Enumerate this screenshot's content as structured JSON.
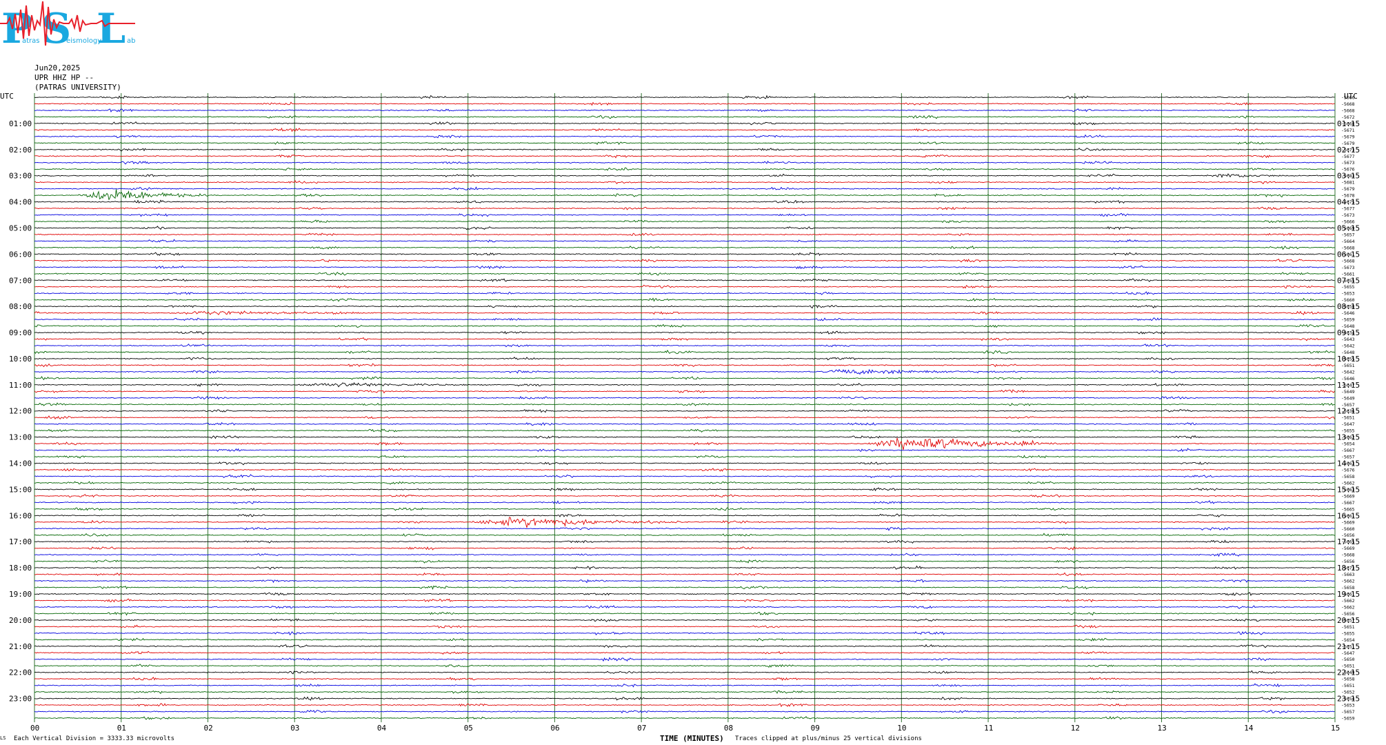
{
  "logo": {
    "letters": [
      "P",
      "S",
      "L"
    ],
    "small_words": [
      "atras",
      "eismology",
      "ab"
    ]
  },
  "header": {
    "date": "Jun20,2025",
    "station": "UPR HHZ HP --",
    "institution": "(PATRAS UNIVERSITY)"
  },
  "axis": {
    "left_label": "UTC",
    "right_label": "UTC",
    "xlabel": "TIME (MINUTES)",
    "xticks": [
      "00",
      "01",
      "02",
      "03",
      "04",
      "05",
      "06",
      "07",
      "08",
      "09",
      "10",
      "11",
      "12",
      "13",
      "14",
      "15"
    ],
    "left_hours": [
      "01:00",
      "02:00",
      "03:00",
      "04:00",
      "05:00",
      "06:00",
      "07:00",
      "08:00",
      "09:00",
      "10:00",
      "11:00",
      "12:00",
      "13:00",
      "14:00",
      "15:00",
      "16:00",
      "17:00",
      "18:00",
      "19:00",
      "20:00",
      "21:00",
      "22:00",
      "23:00"
    ],
    "right_hours": [
      "01:15",
      "02:15",
      "03:15",
      "04:15",
      "05:15",
      "06:15",
      "07:15",
      "08:15",
      "09:15",
      "10:15",
      "11:15",
      "12:15",
      "13:15",
      "14:15",
      "15:15",
      "16:15",
      "17:15",
      "18:15",
      "19:15",
      "20:15",
      "21:15",
      "22:15",
      "23:15"
    ]
  },
  "footer": {
    "mark": "LS",
    "scale_note": "Each Vertical Division = 3333.33 microvolts",
    "clip_note": "Traces clipped at plus/minus 25 vertical divisions"
  },
  "colors": {
    "trace_cycle": [
      "#000000",
      "#e00000",
      "#0000e0",
      "#006400"
    ],
    "grid": "#2f6f2f",
    "logo_blue": "#1aa8e0",
    "logo_red": "#e8202a"
  },
  "chart_data": {
    "type": "line",
    "title": "",
    "xlabel": "TIME (MINUTES)",
    "ylabel": "",
    "xlim": [
      0,
      15
    ],
    "row_count": 96,
    "row_minutes": 15,
    "series_color_cycle": [
      "black",
      "red",
      "blue",
      "green"
    ],
    "right_offsets": [
      "-5666",
      "-5668",
      "-5668",
      "-5672",
      "-5668",
      "-5671",
      "-5679",
      "-5679",
      "-5673",
      "-5677",
      "-5673",
      "-5676",
      "-5683",
      "-5681",
      "-5679",
      "-5678",
      "-5675",
      "-5677",
      "-5673",
      "-5666",
      "-5669",
      "-5657",
      "-5664",
      "-5668",
      "-5661",
      "-5668",
      "-5673",
      "-5661",
      "-5655",
      "-5655",
      "-5653",
      "-5660",
      "-5658",
      "-5646",
      "-5659",
      "-5648",
      "-5634",
      "-5643",
      "-5642",
      "-5648",
      "-5655",
      "-5651",
      "-5642",
      "-5646",
      "-5647",
      "-5649",
      "-5649",
      "-5657",
      "-5636",
      "-5651",
      "-5647",
      "-5655",
      "-5662",
      "-5654",
      "-5667",
      "-5657",
      "-5663",
      "-5676",
      "-5658",
      "-5662",
      "-5663",
      "-5669",
      "-5667",
      "-5665",
      "-5661",
      "-5669",
      "-5660",
      "-5656",
      "-5665",
      "-5669",
      "-5668",
      "-5656",
      "-5673",
      "-5663",
      "-5662",
      "-5658",
      "-5661",
      "-5662",
      "-5662",
      "-5656",
      "-5657",
      "-5651",
      "-5655",
      "-5654",
      "-5651",
      "-5647",
      "-5650",
      "-5651",
      "-5649",
      "-5658",
      "-5651",
      "-5652",
      "-5654",
      "-5653",
      "-5657",
      "-5659"
    ],
    "notable_events": [
      {
        "row": 15,
        "start_min": 0.5,
        "end_min": 2.0,
        "peak_amp": 9,
        "color": "black"
      },
      {
        "row": 53,
        "start_min": 9.5,
        "end_min": 12.0,
        "peak_amp": 9,
        "color": "green"
      },
      {
        "row": 65,
        "start_min": 5.0,
        "end_min": 7.5,
        "peak_amp": 7,
        "color": "red"
      },
      {
        "row": 12,
        "start_min": 13.5,
        "end_min": 14.5,
        "peak_amp": 3,
        "color": "red"
      },
      {
        "row": 42,
        "start_min": 9.0,
        "end_min": 11.5,
        "peak_amp": 3,
        "color": "red"
      },
      {
        "row": 44,
        "start_min": 3.0,
        "end_min": 5.0,
        "peak_amp": 3,
        "color": "blue"
      },
      {
        "row": 33,
        "start_min": 1.5,
        "end_min": 3.5,
        "peak_amp": 3,
        "color": "blue"
      }
    ]
  }
}
